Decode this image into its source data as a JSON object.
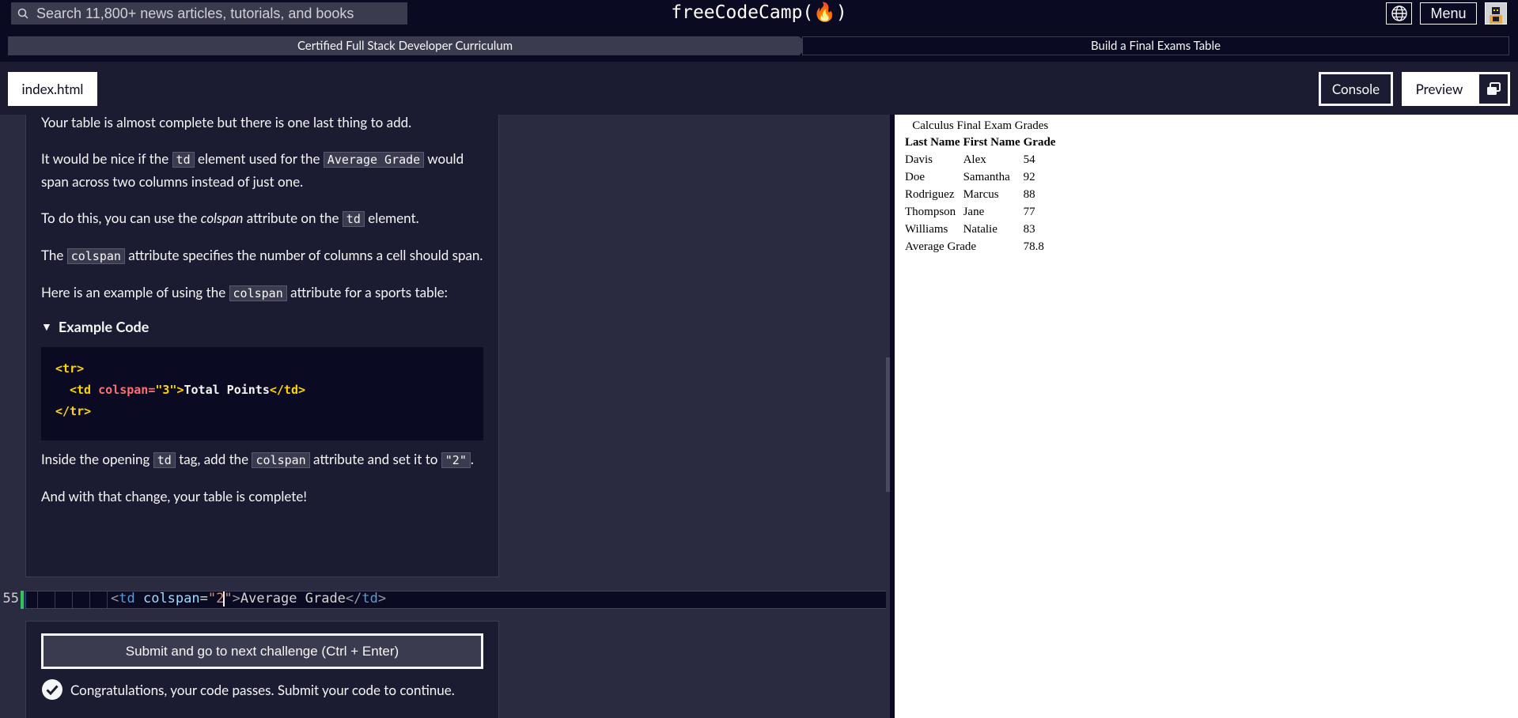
{
  "topnav": {
    "search_placeholder": "Search 11,800+ news articles, tutorials, and books",
    "logo": "freeCodeCamp(🔥)",
    "menu_label": "Menu"
  },
  "breadcrumb": {
    "curriculum": "Certified Full Stack Developer Curriculum",
    "challenge": "Build a Final Exams Table"
  },
  "tabbar": {
    "file_tab": "index.html",
    "console_label": "Console",
    "preview_label": "Preview"
  },
  "instructions": {
    "p1": "Your table is almost complete but there is one last thing to add.",
    "p2_a": "It would be nice if the ",
    "p2_code1": "td",
    "p2_b": " element used for the ",
    "p2_code2": "Average Grade",
    "p2_c": " would span across two columns instead of just one.",
    "p3_a": "To do this, you can use the ",
    "p3_em": "colspan",
    "p3_b": " attribute on the ",
    "p3_code": "td",
    "p3_c": " element.",
    "p4_a": "The ",
    "p4_code": "colspan",
    "p4_b": " attribute specifies the number of columns a cell should span.",
    "p5_a": "Here is an example of using the ",
    "p5_code": "colspan",
    "p5_b": " attribute for a sports table:",
    "example_summary": "Example Code",
    "example": {
      "open_tr": "<tr>",
      "td_open": "<td",
      "attr": " colspan=",
      "val": "\"3\"",
      "close_bracket": ">",
      "text": "Total Points",
      "td_close": "</td>",
      "close_tr": "</tr>"
    },
    "p6_a": "Inside the opening ",
    "p6_code1": "td",
    "p6_b": " tag, add the ",
    "p6_code2": "colspan",
    "p6_c": " attribute and set it to ",
    "p6_code3": "\"2\"",
    "p6_d": ".",
    "p7": "And with that change, your table is complete!"
  },
  "editor_line": {
    "number": "55",
    "lt": "<",
    "tag": "td",
    "attr": " colspan",
    "eq": "=",
    "val_before_cursor": "\"2",
    "val_after_cursor": "\"",
    "gt": ">",
    "text": "Average Grade",
    "close_lt": "</",
    "close_tag": "td",
    "close_gt": ">"
  },
  "lower": {
    "submit_label": "Submit and go to next challenge (Ctrl + Enter)",
    "pass_message": "Congratulations, your code passes. Submit your code to continue."
  },
  "preview": {
    "caption": "Calculus Final Exam Grades",
    "headers": [
      "Last Name",
      "First Name",
      "Grade"
    ],
    "rows": [
      [
        "Davis",
        "Alex",
        "54"
      ],
      [
        "Doe",
        "Samantha",
        "92"
      ],
      [
        "Rodriguez",
        "Marcus",
        "88"
      ],
      [
        "Thompson",
        "Jane",
        "77"
      ],
      [
        "Williams",
        "Natalie",
        "83"
      ]
    ],
    "footer_label": "Average Grade",
    "footer_value": "78.8"
  },
  "colors": {
    "background": "#0a0a23",
    "panel": "#1b1b32",
    "editor": "#2a2a40",
    "accent_green": "#2fc45c"
  }
}
